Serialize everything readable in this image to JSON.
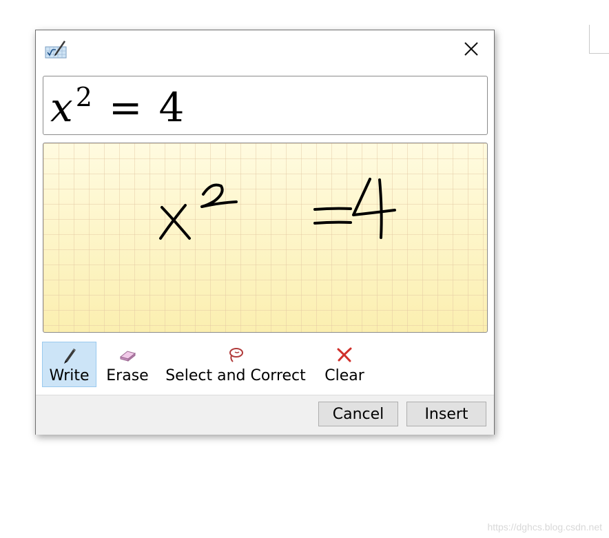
{
  "dialog": {
    "icon": "math-input-icon",
    "close_icon": "close-icon"
  },
  "preview": {
    "base": "x",
    "exponent": "2",
    "equals": "=",
    "rhs": "4"
  },
  "ink": {
    "tokens": [
      "x",
      "2",
      "=",
      "4"
    ],
    "stroke_color": "#000000"
  },
  "toolbar": {
    "write_label": "Write",
    "erase_label": "Erase",
    "select_correct_label": "Select and Correct",
    "clear_label": "Clear",
    "active_tool": "Write"
  },
  "footer": {
    "cancel_label": "Cancel",
    "insert_label": "Insert"
  },
  "watermark": "https://dghcs.blog.csdn.net",
  "colors": {
    "ink_pad": "#fdf5c6",
    "active_tool": "#cce4f7",
    "clear_icon": "#d0302b",
    "select_icon": "#b03a3a"
  }
}
